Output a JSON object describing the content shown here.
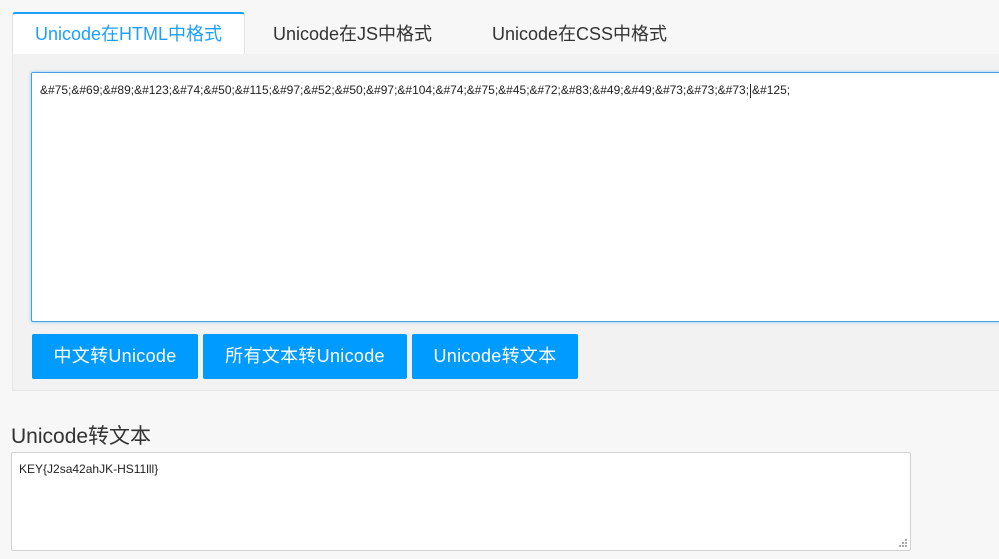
{
  "tabs": [
    {
      "label": "Unicode在HTML中格式",
      "active": true
    },
    {
      "label": "Unicode在JS中格式",
      "active": false
    },
    {
      "label": "Unicode在CSS中格式",
      "active": false
    }
  ],
  "input": {
    "value_before_caret": "&#75;&#69;&#89;&#123;&#74;&#50;&#115;&#97;&#52;&#50;&#97;&#104;&#74;&#75;&#45;&#72;&#83;&#49;&#49;&#73;&#73;&#73;",
    "value_after_caret": "&#125;"
  },
  "buttons": {
    "chinese_to_unicode": "中文转Unicode",
    "all_text_to_unicode": "所有文本转Unicode",
    "unicode_to_text": "Unicode转文本"
  },
  "output": {
    "title": "Unicode转文本",
    "value": "KEY{J2sa42ahJK-HS11lll}"
  },
  "colors": {
    "accent": "#1e9fff",
    "button": "#009bff"
  }
}
